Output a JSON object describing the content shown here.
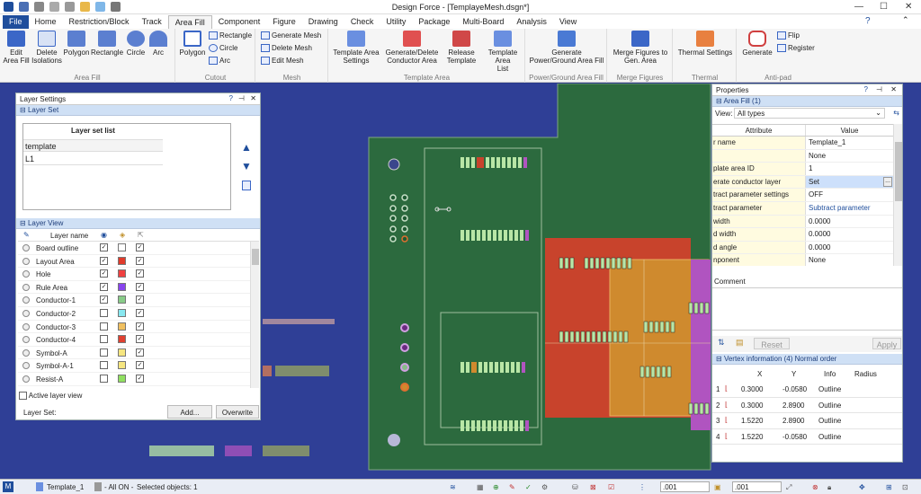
{
  "app": {
    "title": "Design Force - [TemplayeMesh.dsgn*]"
  },
  "menu": [
    "File",
    "Home",
    "Restriction/Block",
    "Track",
    "Area Fill",
    "Component",
    "Figure",
    "Drawing",
    "Check",
    "Utility",
    "Package",
    "Multi-Board",
    "Analysis",
    "View"
  ],
  "ribbon": {
    "area_fill": {
      "label": "Area Fill",
      "edit": "Edit\nArea Fill",
      "delete": "Delete\nIsolations",
      "polygon": "Polygon",
      "rectangle": "Rectangle",
      "circle": "Circle",
      "arc": "Arc"
    },
    "cutout": {
      "label": "Cutout",
      "polygon": "Polygon",
      "rectangle": "Rectangle",
      "circle": "Circle",
      "arc": "Arc"
    },
    "mesh": {
      "label": "Mesh",
      "generate": "Generate Mesh",
      "delete": "Delete Mesh",
      "edit": "Edit Mesh"
    },
    "template_area": {
      "label": "Template Area",
      "settings": "Template Area\nSettings",
      "generate_delete": "Generate/Delete\nConductor Area",
      "release": "Release\nTemplate",
      "list": "Template Area\nList"
    },
    "power_ground": {
      "label": "Power/Ground Area Fill",
      "generate": "Generate\nPower/Ground Area Fill"
    },
    "merge": {
      "label": "Merge Figures",
      "btn": "Merge Figures to\nGen. Area"
    },
    "thermal": {
      "label": "Thermal",
      "btn": "Thermal Settings"
    },
    "antipad": {
      "label": "Anti-pad",
      "generate": "Generate",
      "flip": "Flip",
      "register": "Register"
    }
  },
  "layer_settings": {
    "title": "Layer Settings",
    "layer_set_section": "Layer Set",
    "layer_set_list_header": "Layer set list",
    "layer_sets": [
      "template",
      "L1"
    ],
    "layer_view_section": "Layer View",
    "layer_name_header": "Layer name",
    "layers": [
      {
        "name": "Board outline",
        "color": "#ffffff",
        "visible": true,
        "enabled": true
      },
      {
        "name": "Layout Area",
        "color": "#e03a2a",
        "visible": true,
        "enabled": true
      },
      {
        "name": "Hole",
        "color": "#f04040",
        "visible": true,
        "enabled": true
      },
      {
        "name": "Rule Area",
        "color": "#8844ee",
        "visible": true,
        "enabled": true
      },
      {
        "name": "Conductor-1",
        "color": "#88cc88",
        "visible": true,
        "enabled": true
      },
      {
        "name": "Conductor-2",
        "color": "#88e8f0",
        "visible": false,
        "enabled": true
      },
      {
        "name": "Conductor-3",
        "color": "#f0c060",
        "visible": false,
        "enabled": true
      },
      {
        "name": "Conductor-4",
        "color": "#e04030",
        "visible": false,
        "enabled": true
      },
      {
        "name": "Symbol-A",
        "color": "#f6e680",
        "visible": false,
        "enabled": true
      },
      {
        "name": "Symbol-A-1",
        "color": "#f6e680",
        "visible": false,
        "enabled": true
      },
      {
        "name": "Resist-A",
        "color": "#90e060",
        "visible": false,
        "enabled": true
      }
    ],
    "active_layer_view": "Active layer view",
    "layer_set_label": "Layer Set:",
    "add": "Add...",
    "overwrite": "Overwrite"
  },
  "properties": {
    "title": "Properties",
    "section": "Area Fill (1)",
    "view_label": "View:",
    "view_value": "All types",
    "attr_header": "Attribute",
    "value_header": "Value",
    "rows": [
      {
        "attr": "r name",
        "value": "Template_1"
      },
      {
        "attr": "",
        "value": "None"
      },
      {
        "attr": "plate area ID",
        "value": "1"
      },
      {
        "attr": "erate conductor layer",
        "value": "Set"
      },
      {
        "attr": "tract parameter settings",
        "value": "OFF"
      },
      {
        "attr": "tract parameter",
        "value": "Subtract parameter"
      },
      {
        "attr": "width",
        "value": "0.0000"
      },
      {
        "attr": "d width",
        "value": "0.0000"
      },
      {
        "attr": "d angle",
        "value": "0.0000"
      },
      {
        "attr": "nponent",
        "value": "None"
      }
    ],
    "comment": "Comment",
    "reset": "Reset",
    "apply": "Apply",
    "vertex_section": "Vertex information (4)  Normal order",
    "vertex_headers": [
      "X",
      "Y",
      "Info",
      "Radius"
    ],
    "vertices": [
      {
        "n": "1",
        "x": "0.3000",
        "y": "-0.0580",
        "info": "Outline"
      },
      {
        "n": "2",
        "x": "0.3000",
        "y": "2.8900",
        "info": "Outline"
      },
      {
        "n": "3",
        "x": "1.5220",
        "y": "2.8900",
        "info": "Outline"
      },
      {
        "n": "4",
        "x": "1.5220",
        "y": "-0.0580",
        "info": "Outline"
      }
    ]
  },
  "status": {
    "template": "Template_1",
    "all_on": "- All ON -",
    "selected": "Selected objects: 1",
    "grid1": ".001",
    "grid2": ".001"
  }
}
